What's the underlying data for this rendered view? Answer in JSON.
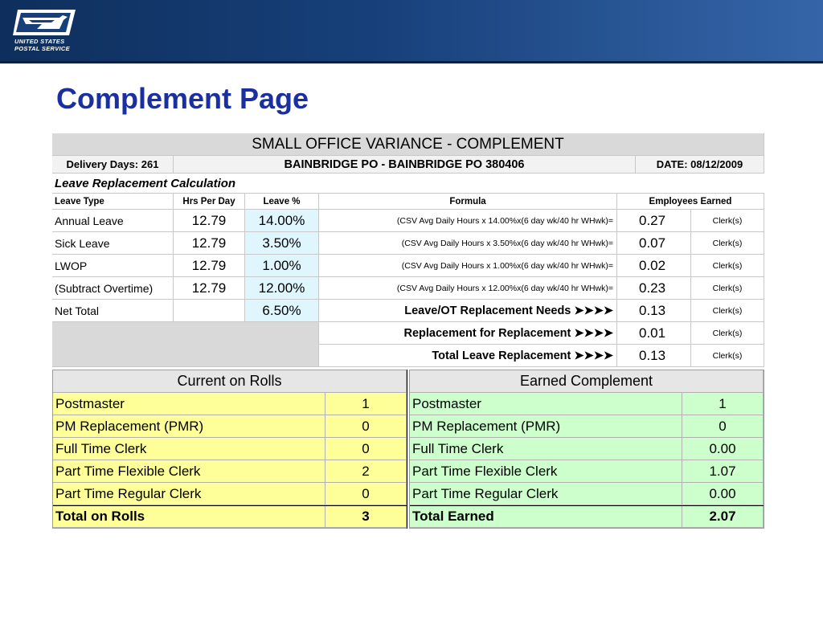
{
  "header": {
    "logo_text_line1": "UNITED STATES",
    "logo_text_line2": "POSTAL SERVICE"
  },
  "page_title": "Complement Page",
  "sheet": {
    "title": "SMALL OFFICE VARIANCE - COMPLEMENT",
    "delivery_days": "Delivery Days: 261",
    "office": "BAINBRIDGE PO - BAINBRIDGE PO   380406",
    "date": "DATE: 08/12/2009",
    "section_title": "Leave Replacement Calculation",
    "columns": {
      "leave_type": "Leave Type",
      "hrs_per_day": "Hrs Per Day",
      "leave_pct": "Leave %",
      "formula": "Formula",
      "employees_earned": "Employees Earned"
    },
    "rows": [
      {
        "type": "Annual Leave",
        "hrs": "12.79",
        "pct": "14.00%",
        "formula": "(CSV Avg Daily Hours x 14.00%x(6 day wk/40 hr WHwk)=",
        "earned": "0.27",
        "unit": "Clerk(s)"
      },
      {
        "type": "Sick Leave",
        "hrs": "12.79",
        "pct": "3.50%",
        "formula": "(CSV Avg Daily Hours x 3.50%x(6 day wk/40 hr WHwk)=",
        "earned": "0.07",
        "unit": "Clerk(s)"
      },
      {
        "type": "LWOP",
        "hrs": "12.79",
        "pct": "1.00%",
        "formula": "(CSV Avg Daily Hours x 1.00%x(6 day wk/40 hr WHwk)=",
        "earned": "0.02",
        "unit": "Clerk(s)"
      },
      {
        "type": "(Subtract Overtime)",
        "hrs": "12.79",
        "pct": "12.00%",
        "formula": "(CSV Avg Daily Hours x 12.00%x(6 day wk/40 hr WHwk)=",
        "earned": "0.23",
        "unit": "Clerk(s)"
      }
    ],
    "net_total": {
      "label": "Net Total",
      "pct": "6.50%",
      "need_label": "Leave/OT Replacement Needs   ➤➤➤➤",
      "earned": "0.13",
      "unit": "Clerk(s)"
    },
    "replacement": {
      "label": "Replacement for Replacement   ➤➤➤➤",
      "earned": "0.01",
      "unit": "Clerk(s)"
    },
    "total_leave": {
      "label": "Total Leave Replacement   ➤➤➤➤",
      "earned": "0.13",
      "unit": "Clerk(s)"
    }
  },
  "current_on_rolls": {
    "title": "Current on Rolls",
    "rows": [
      {
        "label": "Postmaster",
        "value": "1"
      },
      {
        "label": "PM Replacement (PMR)",
        "value": "0"
      },
      {
        "label": "Full Time Clerk",
        "value": "0"
      },
      {
        "label": "Part Time Flexible Clerk",
        "value": "2"
      },
      {
        "label": "Part Time Regular Clerk",
        "value": "0"
      }
    ],
    "total": {
      "label": "Total on Rolls",
      "value": "3"
    }
  },
  "earned_complement": {
    "title": "Earned Complement",
    "rows": [
      {
        "label": "Postmaster",
        "value": "1"
      },
      {
        "label": "PM Replacement (PMR)",
        "value": "0"
      },
      {
        "label": "Full Time Clerk",
        "value": "0.00"
      },
      {
        "label": "Part Time Flexible Clerk",
        "value": "1.07"
      },
      {
        "label": "Part Time Regular Clerk",
        "value": "0.00"
      }
    ],
    "total": {
      "label": "Total Earned",
      "value": "2.07"
    }
  },
  "colors": {
    "header_blue": "#17407a",
    "title_blue": "#1a2fa0",
    "yellow_fill": "#ffff99",
    "green_fill": "#ccffcc",
    "light_blue_fill": "#dff6ff"
  }
}
